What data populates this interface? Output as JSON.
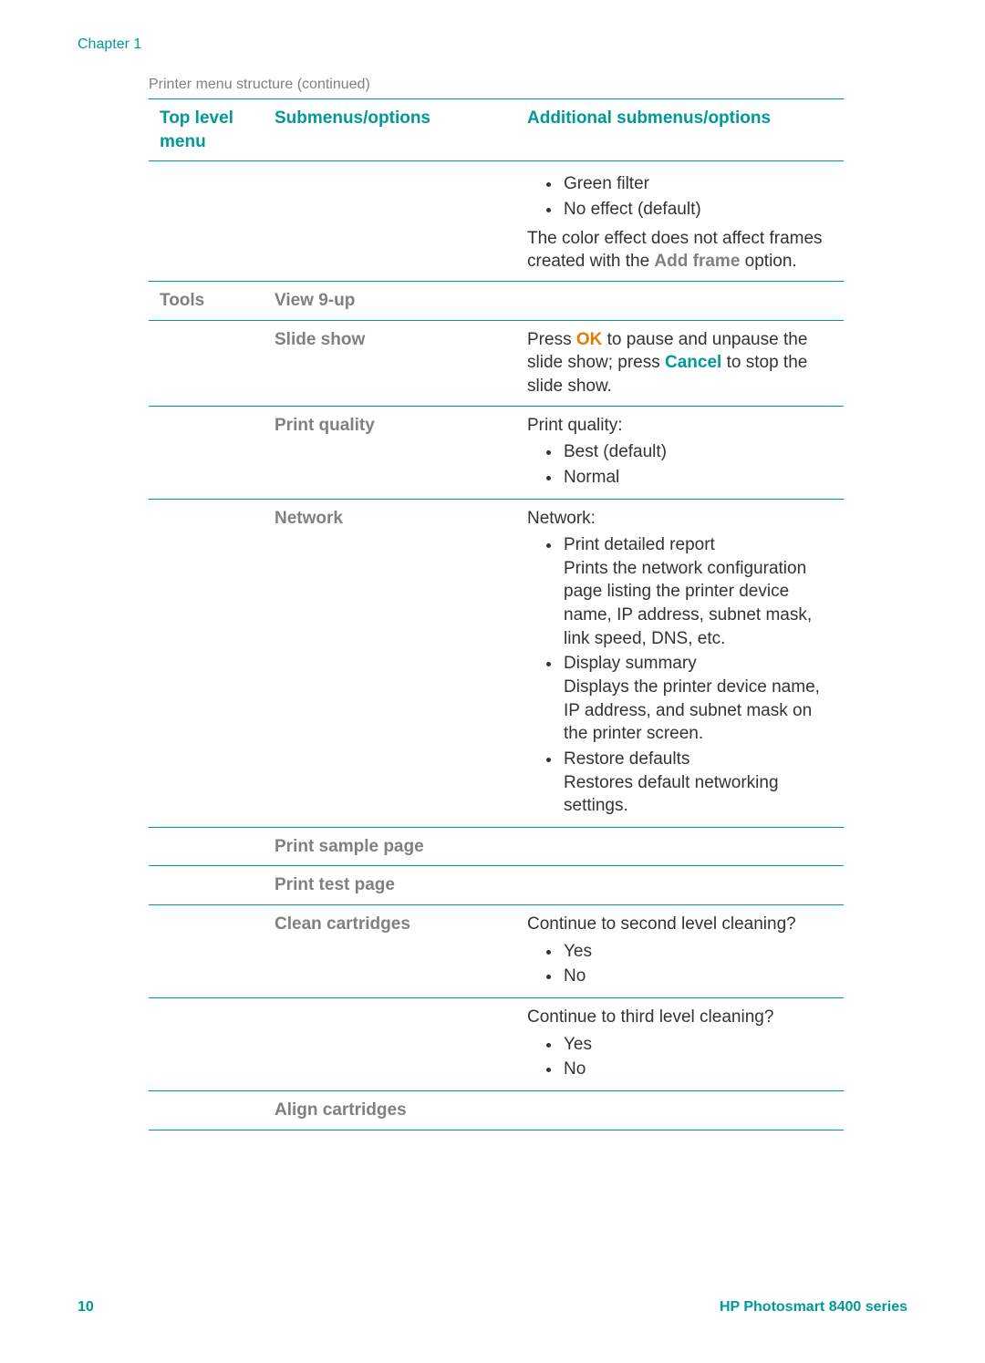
{
  "chapter": "Chapter 1",
  "caption": "Printer menu structure (continued)",
  "headers": {
    "col1": "Top level menu",
    "col2": "Submenus/options",
    "col3": "Additional submenus/options"
  },
  "row_green": {
    "bullets": [
      "Green filter",
      "No effect (default)"
    ],
    "note_pre": "The color effect does not affect frames created with the ",
    "note_bold": "Add frame",
    "note_post": " option."
  },
  "tools_label": "Tools",
  "row_view9": {
    "label": "View 9-up"
  },
  "row_slideshow": {
    "label": "Slide show",
    "press": "Press ",
    "ok": "OK",
    "mid": " to pause and unpause the slide show; press ",
    "cancel": "Cancel",
    "end": " to stop the slide show."
  },
  "row_printquality": {
    "label": "Print quality",
    "title": "Print quality:",
    "bullets": [
      "Best (default)",
      "Normal"
    ]
  },
  "row_network": {
    "label": "Network",
    "title": "Network:",
    "items": [
      {
        "title": "Print detailed report",
        "desc": "Prints the network configuration page listing the printer device name, IP address, subnet mask, link speed, DNS, etc."
      },
      {
        "title": "Display summary",
        "desc": "Displays the printer device name, IP address, and subnet mask on the printer screen."
      },
      {
        "title": "Restore defaults",
        "desc": "Restores default networking settings."
      }
    ]
  },
  "row_printsample": {
    "label": "Print sample page"
  },
  "row_printtest": {
    "label": "Print test page"
  },
  "row_clean": {
    "label": "Clean cartridges",
    "q1": "Continue to second level cleaning?",
    "q1_bullets": [
      "Yes",
      "No"
    ],
    "q2": "Continue to third level cleaning?",
    "q2_bullets": [
      "Yes",
      "No"
    ]
  },
  "row_align": {
    "label": "Align cartridges"
  },
  "footer": {
    "page": "10",
    "product": "HP Photosmart 8400 series"
  }
}
